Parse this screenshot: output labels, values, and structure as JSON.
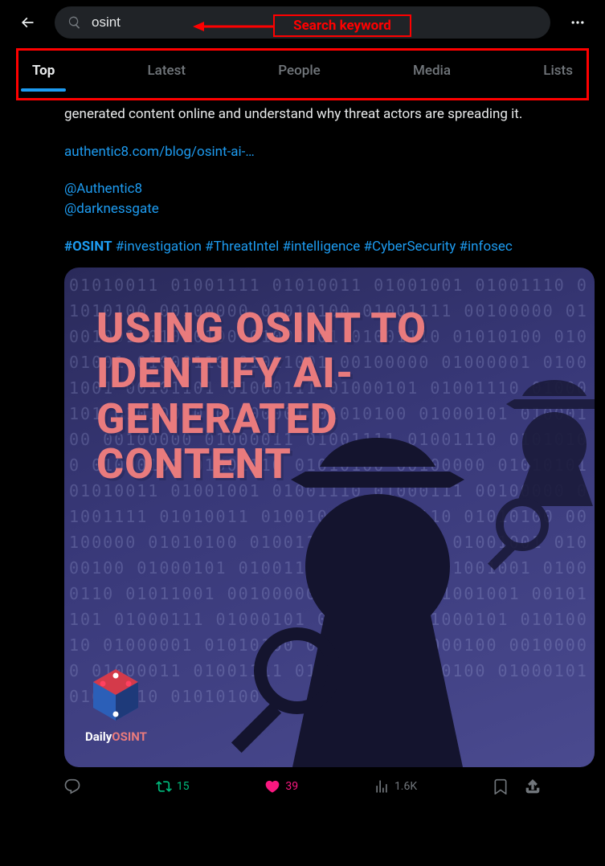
{
  "annotations": {
    "search_label": "Search keyword"
  },
  "search": {
    "value": "osint"
  },
  "tabs": [
    {
      "label": "Top",
      "active": true
    },
    {
      "label": "Latest",
      "active": false
    },
    {
      "label": "People",
      "active": false
    },
    {
      "label": "Media",
      "active": false
    },
    {
      "label": "Lists",
      "active": false
    }
  ],
  "post": {
    "text_fragment": "generated content online and understand why threat actors are spreading it.",
    "link": "authentic8.com/blog/osint-ai-…",
    "mentions": [
      "@Authentic8",
      "@darknessgate"
    ],
    "hashtags": [
      "#OSINT",
      "#investigation",
      "#ThreatIntel",
      "#intelligence",
      "#CyberSecurity",
      "#infosec"
    ],
    "image_title": "USING OSINT TO IDENTIFY AI-GENERATED CONTENT",
    "image_brand_prefix": "Daily",
    "image_brand_suffix": "OSINT"
  },
  "actions": {
    "retweets": "15",
    "likes": "39",
    "views": "1.6K"
  }
}
